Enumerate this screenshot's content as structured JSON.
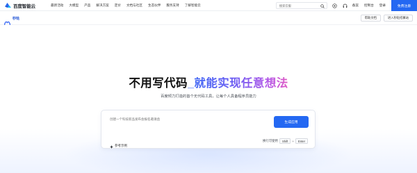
{
  "topnav": {
    "brand": "百度智能云",
    "items": [
      "最新活动",
      "大模型",
      "产品",
      "解决方案",
      "定价",
      "文档与社区",
      "生态伙伴",
      "服务支持",
      "了解智能云"
    ],
    "search_placeholder": "搜索云服",
    "links": [
      "备案",
      "控制台",
      "登录"
    ],
    "register_label": "免费注册"
  },
  "subbar": {
    "product_name": "秒哒",
    "help_label": "帮助文档",
    "community_label": "进入秒哒招募站"
  },
  "hero": {
    "headline_part1": "不用写代码",
    "headline_part2": "_就能实现任意想法",
    "subtitle": "百度倾力打造的首个无代码工具，让每个人具备程序员能力",
    "prompt_placeholder": "创建一个科技新品发布会报名邀请函",
    "generate_label": "生成应用",
    "examples_label": "参考示例",
    "hint_text": "换行可使用",
    "shortcut_key1": "Shift",
    "shortcut_plus": "+",
    "shortcut_key2": "Enter"
  },
  "colors": {
    "accent": "#2468f2",
    "gradient_start": "#3f6df5",
    "gradient_end": "#e05cc4"
  },
  "icons": [
    "baidu-cloud-logo-icon",
    "search-icon",
    "support-icon",
    "headset-icon",
    "miaoda-logo-icon",
    "sparkle-icon"
  ]
}
